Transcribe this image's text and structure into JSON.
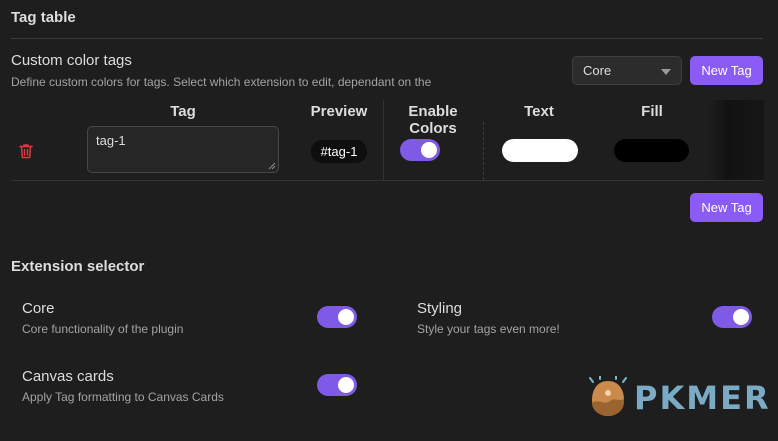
{
  "tag_table": {
    "heading": "Tag table",
    "custom_color_tags": {
      "name": "Custom color tags",
      "description": "Define custom colors for tags. Select which extension to edit, dependant on the",
      "select_value": "Core",
      "new_tag_label": "New Tag"
    },
    "columns": [
      "Tag",
      "Preview",
      "Enable Colors",
      "Text",
      "Fill"
    ],
    "rows": [
      {
        "tag": "tag-1",
        "preview": "#tag-1",
        "enable_colors": true,
        "text_color": "#ffffff",
        "fill_color": "#000000"
      }
    ],
    "bottom_new_tag_label": "New Tag"
  },
  "extension_selector": {
    "heading": "Extension selector",
    "items": [
      {
        "name": "Core",
        "description": "Core functionality of the plugin",
        "enabled": true
      },
      {
        "name": "Styling",
        "description": "Style your tags even more!",
        "enabled": true
      },
      {
        "name": "Canvas cards",
        "description": "Apply Tag formatting to Canvas Cards",
        "enabled": true
      }
    ]
  },
  "watermark": {
    "text": "PKMER"
  },
  "colors": {
    "accent": "#8a5cf5",
    "delete": "#e0393e",
    "background": "#1e1e1e"
  },
  "icons": [
    "trash-icon",
    "chevron-down-icon",
    "resize-grip-icon",
    "pkmer-logo-icon"
  ]
}
